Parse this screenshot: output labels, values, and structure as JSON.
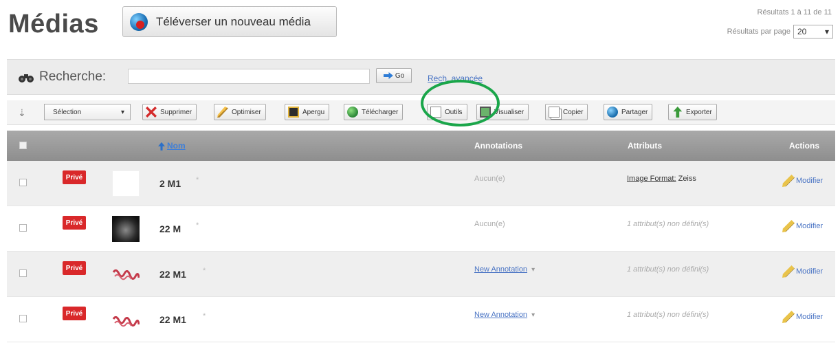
{
  "header": {
    "title": "Médias",
    "upload_label": "Téléverser un nouveau média",
    "results_text": "Résultats 1 à 11 de 11",
    "per_page_label": "Résultats par page",
    "per_page_value": "20"
  },
  "search": {
    "label": "Recherche:",
    "value": "",
    "go_label": "Go",
    "advanced_label": "Rech. avancée"
  },
  "toolbar": {
    "selection_label": "Sélection",
    "buttons": {
      "delete": "Supprimer",
      "optimize": "Optimiser",
      "preview": "Apergu",
      "download": "Télécharger",
      "tools": "Outils",
      "view": "Visualiser",
      "copy": "Copier",
      "share": "Partager",
      "export": "Exporter"
    }
  },
  "table": {
    "columns": {
      "name": "Nom",
      "annotations": "Annotations",
      "attributes": "Attributs",
      "actions": "Actions"
    },
    "rows": [
      {
        "badge": "Privé",
        "name": "2 M1",
        "star": "*",
        "annotation": "Aucun(e)",
        "attr_key": "Image Format:",
        "attr_value": "Zeiss",
        "action": "Modifier"
      },
      {
        "badge": "Privé",
        "name": "22 M",
        "star": "*",
        "annotation": "Aucun(e)",
        "attribute": "1 attribut(s) non défini(s)",
        "action": "Modifier"
      },
      {
        "badge": "Privé",
        "name": "22 M1",
        "star": "*",
        "annotation": "New Annotation",
        "annotation_caret": "▾",
        "attribute": "1 attribut(s) non défini(s)",
        "action": "Modifier"
      },
      {
        "badge": "Privé",
        "name": "22 M1",
        "star": "*",
        "annotation": "New Annotation",
        "annotation_caret": "▾",
        "attribute": "1 attribut(s) non défini(s)",
        "action": "Modifier"
      }
    ]
  },
  "colors": {
    "badge_red": "#d9282a",
    "link_blue": "#4a74c4",
    "highlight_green": "#1aa64a",
    "header_gray": "#9a9a9a"
  }
}
